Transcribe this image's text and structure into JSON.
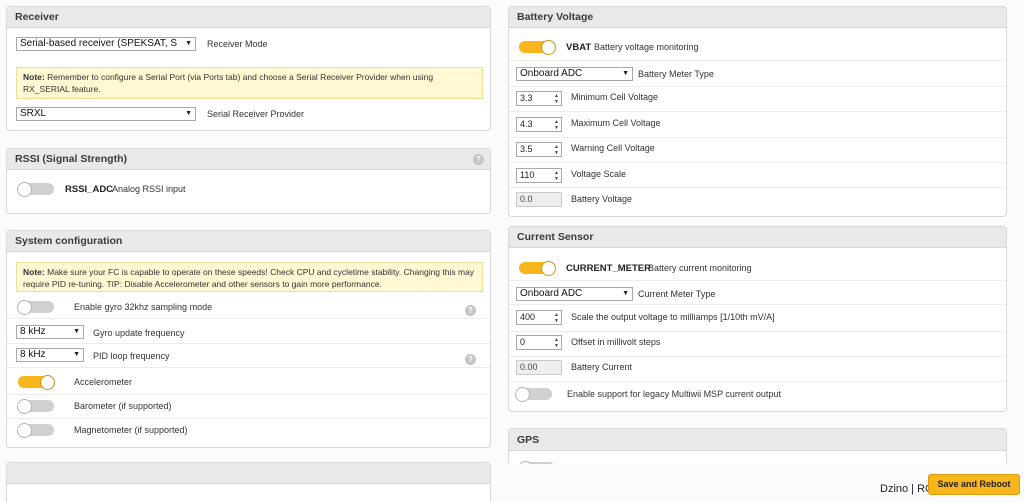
{
  "receiver": {
    "title": "Receiver",
    "mode_value": "Serial-based receiver (SPEKSAT, S",
    "mode_label": "Receiver Mode",
    "note_label": "Note:",
    "note_text": "Remember to configure a Serial Port (via Ports tab) and choose a Serial Receiver Provider when using RX_SERIAL feature.",
    "provider_value": "SRXL",
    "provider_label": "Serial Receiver Provider"
  },
  "rssi": {
    "title": "RSSI (Signal Strength)",
    "toggle_name": "RSSI_ADC",
    "toggle_desc": "Analog RSSI input",
    "toggle_on": false
  },
  "system": {
    "title": "System configuration",
    "note_label": "Note:",
    "note_text": "Make sure your FC is capable to operate on these speeds! Check CPU and cycletime stability. Changing this may require PID re-tuning. TIP: Disable Accelerometer and other sensors to gain more performance.",
    "gyro32_label": "Enable gyro 32khz sampling mode",
    "gyro32_on": false,
    "gyro_freq_value": "8 kHz",
    "gyro_freq_label": "Gyro update frequency",
    "pid_freq_value": "8 kHz",
    "pid_freq_label": "PID loop frequency",
    "accel_label": "Accelerometer",
    "accel_on": true,
    "baro_label": "Barometer (if supported)",
    "baro_on": false,
    "mag_label": "Magnetometer (if supported)",
    "mag_on": false
  },
  "battery": {
    "title": "Battery Voltage",
    "vbat_name": "VBAT",
    "vbat_desc": "Battery voltage monitoring",
    "vbat_on": true,
    "meter_type_value": "Onboard ADC",
    "meter_type_label": "Battery Meter Type",
    "min_cell_value": "3.3",
    "min_cell_label": "Minimum Cell Voltage",
    "max_cell_value": "4.3",
    "max_cell_label": "Maximum Cell Voltage",
    "warn_cell_value": "3.5",
    "warn_cell_label": "Warning Cell Voltage",
    "scale_value": "110",
    "scale_label": "Voltage Scale",
    "voltage_value": "0.0",
    "voltage_label": "Battery Voltage"
  },
  "current": {
    "title": "Current Sensor",
    "meter_name": "CURRENT_METER",
    "meter_desc": "Battery current monitoring",
    "meter_on": true,
    "meter_type_value": "Onboard ADC",
    "meter_type_label": "Current Meter Type",
    "scale_value": "400",
    "scale_label": "Scale the output voltage to milliamps [1/10th mV/A]",
    "offset_value": "0",
    "offset_label": "Offset in millivolt steps",
    "current_value": "0.00",
    "current_label": "Battery Current",
    "legacy_label": "Enable support for legacy Multiwii MSP current output",
    "legacy_on": false
  },
  "gps": {
    "title": "GPS"
  },
  "footer": {
    "save_label": "Save and Reboot",
    "watermark": "Dzino | RCportal.sk"
  },
  "icons": {
    "help": "help-icon",
    "dropdown": "chevron-down-icon",
    "spin": "spinner-arrows-icon"
  },
  "colors": {
    "accent": "#f8b51c",
    "note_bg": "#fff8d3",
    "header_bg": "#e9e9e9"
  }
}
